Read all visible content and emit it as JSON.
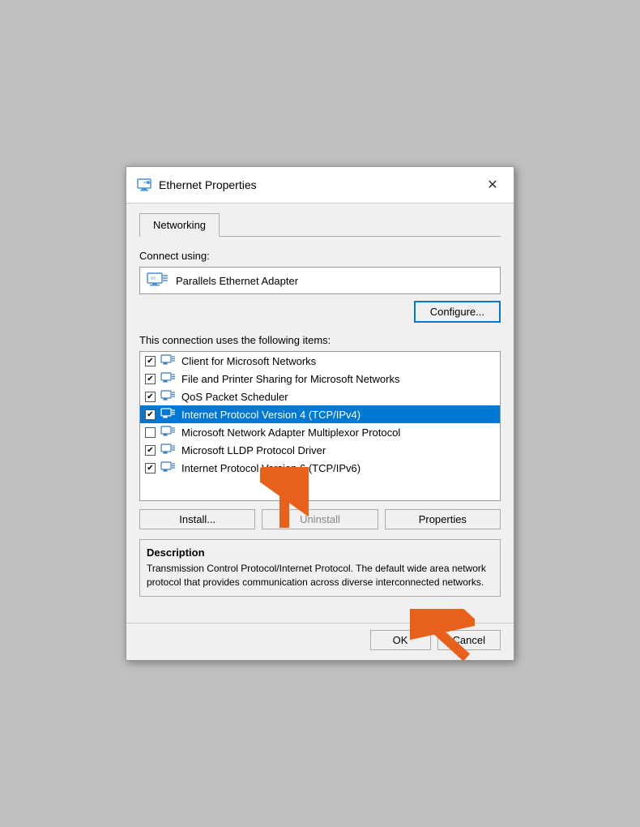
{
  "dialog": {
    "title": "Ethernet Properties",
    "close_label": "✕",
    "icon_label": "ethernet-icon"
  },
  "tabs": [
    {
      "id": "networking",
      "label": "Networking",
      "active": true
    }
  ],
  "connect_using": {
    "label": "Connect using:",
    "adapter": {
      "name": "Parallels Ethernet Adapter",
      "icon": "monitor-icon"
    }
  },
  "configure_button": "Configure...",
  "items_section": {
    "label": "This connection uses the following items:",
    "items": [
      {
        "id": "client-ms-networks",
        "checked": true,
        "text": "Client for Microsoft Networks",
        "icon": "network-client-icon"
      },
      {
        "id": "file-printer-sharing",
        "checked": true,
        "text": "File and Printer Sharing for Microsoft Networks",
        "icon": "network-share-icon"
      },
      {
        "id": "qos-scheduler",
        "checked": true,
        "text": "QoS Packet Scheduler",
        "icon": "network-qos-icon"
      },
      {
        "id": "ipv4",
        "checked": true,
        "text": "Internet Protocol Version 4 (TCP/IPv4)",
        "icon": "network-protocol-icon",
        "selected": true
      },
      {
        "id": "ms-network-adapter",
        "checked": false,
        "text": "Microsoft Network Adapter Multiplexor Protocol",
        "icon": "network-protocol-icon",
        "selected": false
      },
      {
        "id": "ms-lldp",
        "checked": true,
        "text": "Microsoft LLDP Protocol Driver",
        "icon": "network-protocol-icon",
        "selected": false
      },
      {
        "id": "ipv6",
        "checked": true,
        "text": "Internet Protocol Version 6 (TCP/IPv6)",
        "icon": "network-protocol-icon",
        "selected": false
      }
    ]
  },
  "action_buttons": {
    "install": "Install...",
    "uninstall": "Uninstall",
    "properties": "Properties"
  },
  "description": {
    "title": "Description",
    "text": "Transmission Control Protocol/Internet Protocol. The default wide area network protocol that provides communication across diverse interconnected networks."
  },
  "footer": {
    "ok": "OK",
    "cancel": "Cancel"
  }
}
